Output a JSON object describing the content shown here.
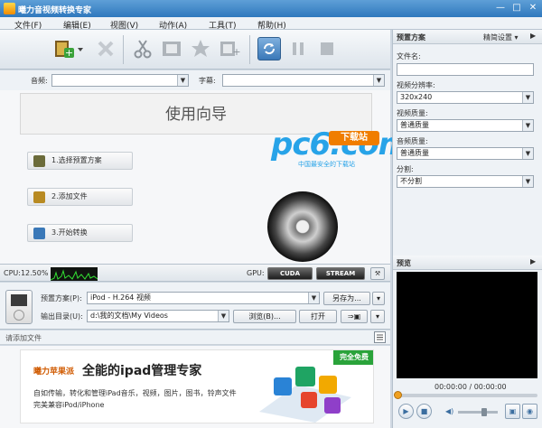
{
  "window": {
    "title": "曦力音视频转换专家",
    "min": "—",
    "max": "□",
    "close": "✕"
  },
  "menu": [
    "文件(F)",
    "编辑(E)",
    "视图(V)",
    "动作(A)",
    "工具(T)",
    "帮助(H)"
  ],
  "tracks": {
    "audio_label": "音频:",
    "subtitle_label": "字幕:",
    "audio_value": "",
    "subtitle_value": ""
  },
  "wizard": {
    "title": "使用向导",
    "step1": "1.选择预置方案",
    "step2": "2.添加文件",
    "step3": "3.开始转换"
  },
  "watermark": {
    "logo": "pc6.com",
    "badge": "下载站",
    "slogan": "中国最安全的下载站"
  },
  "status": {
    "cpu": "CPU:12.50%",
    "gpu": "GPU:",
    "cuda": "CUDA",
    "stream": "STREAM"
  },
  "output": {
    "preset_label": "预置方案(P):",
    "preset_value": "iPod - H.264 视频",
    "save_as": "另存为...",
    "outdir_label": "输出目录(U):",
    "outdir_value": "d:\\我的文档\\My Videos",
    "browse": "浏览(B)...",
    "open": "打开"
  },
  "dropzone": {
    "hint": "请添加文件"
  },
  "ad": {
    "brand": "曦力苹果派",
    "headline": "全能的ipad管理专家",
    "line1": "自如传输，转化和管理iPad音乐，视频，图片，图书，铃声文件",
    "line2": "完美兼容iPod/iPhone",
    "ribbon": "完全免费"
  },
  "right_panel": {
    "header": "预置方案",
    "precise": "精简设置 ▾",
    "filename_label": "文件名:",
    "filename_value": "",
    "resolution_label": "视频分辨率:",
    "resolution_value": "320x240",
    "vquality_label": "视频质量:",
    "vquality_value": "普通质量",
    "aquality_label": "音频质量:",
    "aquality_value": "普通质量",
    "split_label": "分割:",
    "split_value": "不分割",
    "preview_header": "预览",
    "time": "00:00:00 / 00:00:00"
  }
}
